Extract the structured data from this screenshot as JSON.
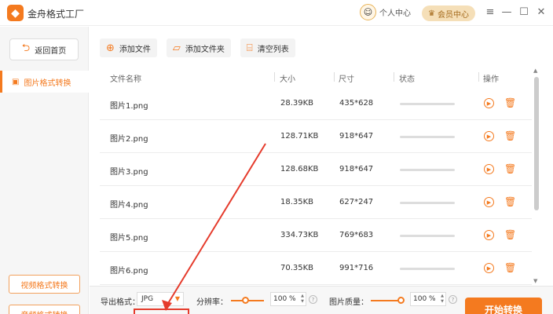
{
  "app": {
    "title": "金舟格式工厂",
    "logo_glyph": "◆"
  },
  "header": {
    "user_center": "个人中心",
    "member_center": "会员中心",
    "minimize": "—",
    "maximize": "☐",
    "close": "✕"
  },
  "sidebar": {
    "back_label": "返回首页",
    "active_item": "图片格式转换",
    "video_convert": "视频格式转换",
    "audio_convert": "音频格式转换"
  },
  "toolbar": {
    "add_file": "添加文件",
    "add_folder": "添加文件夹",
    "clear_list": "清空列表"
  },
  "table": {
    "columns": [
      "文件名称",
      "大小",
      "尺寸",
      "状态",
      "操作"
    ],
    "rows": [
      {
        "name": "图片1.png",
        "size": "28.39KB",
        "dims": "435*628"
      },
      {
        "name": "图片2.png",
        "size": "128.71KB",
        "dims": "918*647"
      },
      {
        "name": "图片3.png",
        "size": "128.68KB",
        "dims": "918*647"
      },
      {
        "name": "图片4.png",
        "size": "18.35KB",
        "dims": "627*247"
      },
      {
        "name": "图片5.png",
        "size": "334.73KB",
        "dims": "769*683"
      },
      {
        "name": "图片6.png",
        "size": "70.35KB",
        "dims": "991*716"
      }
    ]
  },
  "bottom": {
    "format_label": "导出格式：",
    "format_value": "JPG",
    "resolution_label": "分辨率：",
    "resolution_value": "100 %",
    "quality_label": "图片质量：",
    "quality_value": "100 %",
    "convert_label": "开始转换"
  },
  "colors": {
    "accent": "#f47a1f",
    "annotation": "#e53b2c"
  }
}
